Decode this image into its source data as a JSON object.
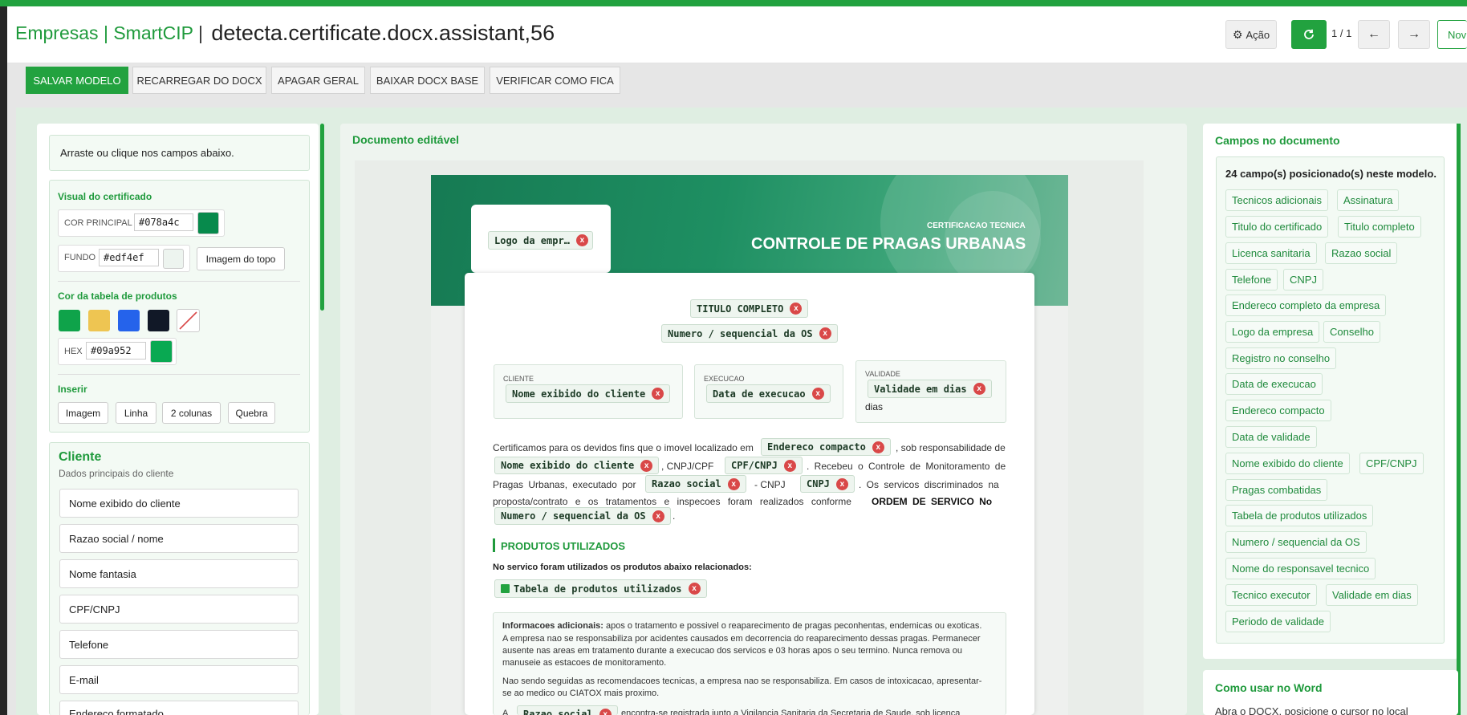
{
  "header": {
    "brand_left": "Empresas",
    "brand_sep": "|",
    "brand_right": "SmartCIP",
    "brand_sep2": "|",
    "title": "detecta.certificate.docx.assistant,56",
    "action_label": "Ação",
    "pager": "1 / 1",
    "new_label": "Nov"
  },
  "toolbar": {
    "buttons": [
      "SALVAR MODELO",
      "RECARREGAR DO DOCX",
      "APAGAR GERAL",
      "BAIXAR DOCX BASE",
      "VERIFICAR COMO FICA"
    ]
  },
  "left": {
    "hint": "Arraste ou clique nos campos abaixo.",
    "visual_title": "Visual do certificado",
    "main_color_label": "COR PRINCIPAL",
    "main_color": "#078a4c",
    "bg_label": "FUNDO",
    "bg_color": "#edf4ef",
    "top_image_label": "Imagem do topo",
    "table_color_title": "Cor da tabela de produtos",
    "swatches": [
      "#0fa34a",
      "#eec552",
      "#2563eb",
      "#111827"
    ],
    "hex_label": "HEX",
    "hex_value": "#09a952",
    "insert_title": "Inserir",
    "insert_buttons": [
      "Imagem",
      "Linha",
      "2 colunas",
      "Quebra"
    ],
    "client_title": "Cliente",
    "client_subtitle": "Dados principais do cliente",
    "client_fields": [
      "Nome exibido do cliente",
      "Razao social / nome",
      "Nome fantasia",
      "CPF/CNPJ",
      "Telefone",
      "E-mail",
      "Endereco formatado"
    ]
  },
  "center": {
    "title": "Documento editável",
    "hero_kicker": "CERTIFICACAO TECNICA",
    "hero_title": "CONTROLE DE PRAGAS URBANAS",
    "logo_chip": "Logo da empr…",
    "title_chip": "TITULO COMPLETO",
    "os_chip": "Numero / sequencial da OS",
    "cliente_label": "CLIENTE",
    "cliente_chip": "Nome exibido do cliente",
    "execucao_label": "EXECUCAO",
    "execucao_chip": "Data de execucao",
    "validade_label": "VALIDADE",
    "validade_chip": "Validade em dias",
    "validade_suffix": "dias",
    "p1_a": "Certificamos para os devidos fins que o imovel localizado em",
    "p1_chip1": "Endereco compacto",
    "p1_b": ", sob responsabilidade de",
    "p1_chip2": "Nome exibido do cliente",
    "p1_c": ", CNPJ/CPF",
    "p1_chip3": "CPF/CNPJ",
    "p1_d": ". Recebeu o Controle de Monitoramento de",
    "p1_e": "Pragas Urbanas, executado por",
    "p1_chip4": "Razao social",
    "p1_f": "- CNPJ",
    "p1_chip5": "CNPJ",
    "p1_g": ". Os servicos discriminados na",
    "p1_h": "proposta/contrato e os tratamentos e inspecoes foram realizados conforme",
    "p1_bold": "ORDEM DE SERVICO No",
    "p1_chip6": "Numero / sequencial da OS",
    "p1_end": ".",
    "produtos_title": "PRODUTOS UTILIZADOS",
    "produtos_text": "No servico foram utilizados os produtos abaixo relacionados:",
    "produtos_chip": "Tabela de produtos utilizados",
    "info_bold": "Informacoes adicionais:",
    "info_l1": "apos o tratamento e possivel o reaparecimento de pragas peconhentas, endemicas ou exoticas.",
    "info_l2": "A empresa nao se responsabiliza por acidentes causados em decorrencia do reaparecimento dessas pragas. Permanecer",
    "info_l3": "ausente nas areas em tratamento durante a execucao dos servicos e 03 horas apos o seu termino. Nunca remova ou",
    "info_l4": "manuseie as estacoes de monitoramento.",
    "info_l5": "Nao sendo seguidas as recomendacoes tecnicas, a empresa nao se responsabiliza. Em casos de intoxicacao, apresentar-",
    "info_l6": "se ao medico ou CIATOX mais proximo.",
    "info_l7a": "A",
    "info_chip": "Razao social",
    "info_l7b": "encontra-se registrada junto a Vigilancia Sanitaria da Secretaria de Saude, sob licenca"
  },
  "right": {
    "title": "Campos no documento",
    "count_text": "24 campo(s) posicionado(s) neste modelo.",
    "tags": [
      "Tecnicos adicionais",
      "Assinatura",
      "Titulo do certificado",
      "Titulo completo",
      "Licenca sanitaria",
      "Razao social",
      "Telefone",
      "CNPJ",
      "Endereco completo da empresa",
      "Logo da empresa",
      "Conselho",
      "Registro no conselho",
      "Data de execucao",
      "Endereco compacto",
      "Data de validade",
      "Nome exibido do cliente",
      "CPF/CNPJ",
      "Pragas combatidas",
      "Tabela de produtos utilizados",
      "Numero / sequencial da OS",
      "Nome do responsavel tecnico",
      "Tecnico executor",
      "Validade em dias",
      "Periodo de validade"
    ],
    "howto_title": "Como usar no Word",
    "howto_text": "Abra o DOCX, posicione o cursor no local"
  }
}
